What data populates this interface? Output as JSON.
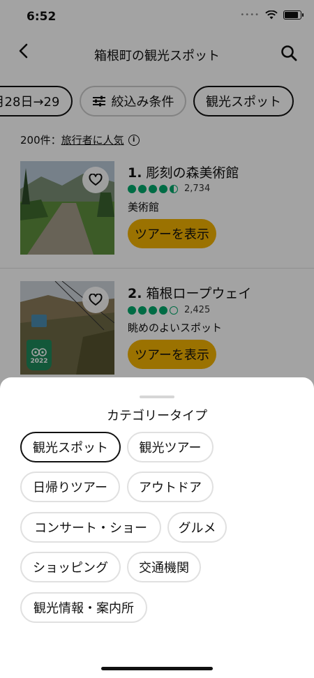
{
  "status": {
    "time": "6:52"
  },
  "header": {
    "title": "箱根町の観光スポット",
    "back_icon": "chevron-left-icon",
    "search_icon": "search-icon"
  },
  "filters": {
    "date_chip": "月28日→29",
    "filter_chip": "絞込み条件",
    "category_chip": "観光スポット"
  },
  "results": {
    "count": "200件：",
    "sort": "旅行者に人気",
    "items": [
      {
        "rank": "1.",
        "name": "彫刻の森美術館",
        "rating": 4.5,
        "reviews": "2,734",
        "category": "美術館",
        "button": "ツアーを表示"
      },
      {
        "rank": "2.",
        "name": "箱根ロープウェイ",
        "rating": 4.0,
        "reviews": "2,425",
        "category": "眺めのよいスポット",
        "button": "ツアーを表示",
        "badge_year": "2022"
      }
    ]
  },
  "sheet": {
    "title": "カテゴリータイプ",
    "options": [
      "観光スポット",
      "観光ツアー",
      "日帰りツアー",
      "アウトドア",
      "コンサート・ショー",
      "グルメ",
      "ショッピング",
      "交通機関",
      "観光情報・案内所"
    ],
    "selected": "観光スポット"
  },
  "colors": {
    "accent": "#f2b203",
    "rating": "#00aa6c",
    "badge": "#1f8a5c"
  }
}
